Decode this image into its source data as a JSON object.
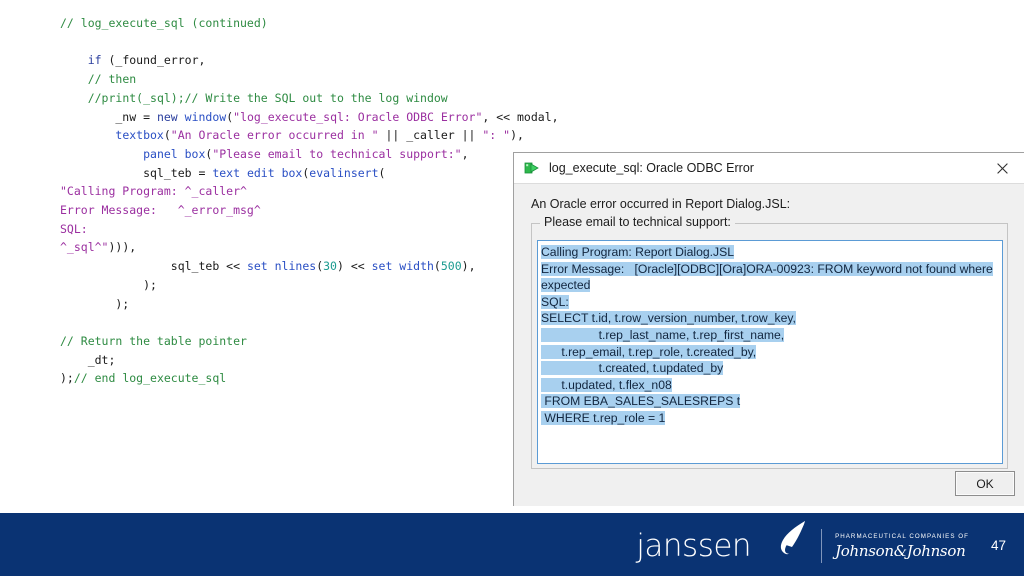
{
  "slide": {
    "page_number": "47",
    "code_lines": [
      [
        {
          "t": "// log_execute_sql (continued)",
          "c": "cmt"
        }
      ],
      [],
      [
        {
          "t": "    ",
          "c": "plain"
        },
        {
          "t": "if",
          "c": "kw"
        },
        {
          "t": " (_found_error,",
          "c": "plain"
        }
      ],
      [
        {
          "t": "    ",
          "c": "plain"
        },
        {
          "t": "// then",
          "c": "cmt"
        }
      ],
      [
        {
          "t": "    ",
          "c": "plain"
        },
        {
          "t": "//print(_sql);// Write the SQL out to the log window",
          "c": "cmt"
        }
      ],
      [
        {
          "t": "        _nw = ",
          "c": "plain"
        },
        {
          "t": "new",
          "c": "kw"
        },
        {
          "t": " ",
          "c": "plain"
        },
        {
          "t": "window",
          "c": "fn"
        },
        {
          "t": "(",
          "c": "plain"
        },
        {
          "t": "\"log_execute_sql: Oracle ODBC Error\"",
          "c": "str"
        },
        {
          "t": ", << modal,",
          "c": "plain"
        }
      ],
      [
        {
          "t": "        ",
          "c": "plain"
        },
        {
          "t": "textbox",
          "c": "fn"
        },
        {
          "t": "(",
          "c": "plain"
        },
        {
          "t": "\"An Oracle error occurred in \"",
          "c": "str"
        },
        {
          "t": " || _caller || ",
          "c": "plain"
        },
        {
          "t": "\": \"",
          "c": "str"
        },
        {
          "t": "),",
          "c": "plain"
        }
      ],
      [
        {
          "t": "            ",
          "c": "plain"
        },
        {
          "t": "panel box",
          "c": "fn"
        },
        {
          "t": "(",
          "c": "plain"
        },
        {
          "t": "\"Please email to technical support:\"",
          "c": "str"
        },
        {
          "t": ",",
          "c": "plain"
        }
      ],
      [
        {
          "t": "            sql_teb = ",
          "c": "plain"
        },
        {
          "t": "text edit box",
          "c": "fn"
        },
        {
          "t": "(",
          "c": "plain"
        },
        {
          "t": "evalinsert",
          "c": "fn"
        },
        {
          "t": "(",
          "c": "plain"
        }
      ],
      [
        {
          "t": "\"Calling Program: ^_caller^",
          "c": "str"
        }
      ],
      [
        {
          "t": "Error Message:   ^_error_msg^",
          "c": "str"
        }
      ],
      [
        {
          "t": "SQL:",
          "c": "str"
        }
      ],
      [
        {
          "t": "^_sql^\"",
          "c": "str"
        },
        {
          "t": "))),",
          "c": "plain"
        }
      ],
      [
        {
          "t": "                sql_teb << ",
          "c": "plain"
        },
        {
          "t": "set nlines",
          "c": "fn"
        },
        {
          "t": "(",
          "c": "plain"
        },
        {
          "t": "30",
          "c": "num"
        },
        {
          "t": ") << ",
          "c": "plain"
        },
        {
          "t": "set width",
          "c": "fn"
        },
        {
          "t": "(",
          "c": "plain"
        },
        {
          "t": "500",
          "c": "num"
        },
        {
          "t": "),",
          "c": "plain"
        }
      ],
      [
        {
          "t": "            );",
          "c": "plain"
        }
      ],
      [
        {
          "t": "        );",
          "c": "plain"
        }
      ],
      [],
      [
        {
          "t": "// Return the table pointer",
          "c": "cmt"
        }
      ],
      [
        {
          "t": "    _dt;",
          "c": "plain"
        }
      ],
      [
        {
          "t": ");",
          "c": "plain"
        },
        {
          "t": "// end log_execute_sql",
          "c": "cmt"
        }
      ]
    ]
  },
  "dialog": {
    "icon": "green-arrow-app-icon",
    "title": "log_execute_sql: Oracle ODBC Error",
    "close_label": "close-icon",
    "error_line": "An Oracle error occurred in Report Dialog.JSL:",
    "group_legend": "Please email to technical support:",
    "text_content_lines": [
      "Calling Program: Report Dialog.JSL",
      "Error Message:   [Oracle][ODBC][Ora]ORA-00923: FROM keyword not found where",
      "expected",
      "SQL:",
      "SELECT t.id, t.row_version_number, t.row_key,",
      "                 t.rep_last_name, t.rep_first_name,",
      "      t.rep_email, t.rep_role, t.created_by,",
      "                 t.created, t.updated_by",
      "      t.updated, t.flex_n08",
      " FROM EBA_SALES_SALESREPS t",
      " WHERE t.rep_role = 1"
    ],
    "ok_label": "OK"
  },
  "footer": {
    "brand_word": "janssen",
    "jnj_tagline": "PHARMACEUTICAL COMPANIES OF",
    "jnj_name": "Johnson&Johnson",
    "page_number": "47",
    "brand_color": "#0a3373"
  }
}
